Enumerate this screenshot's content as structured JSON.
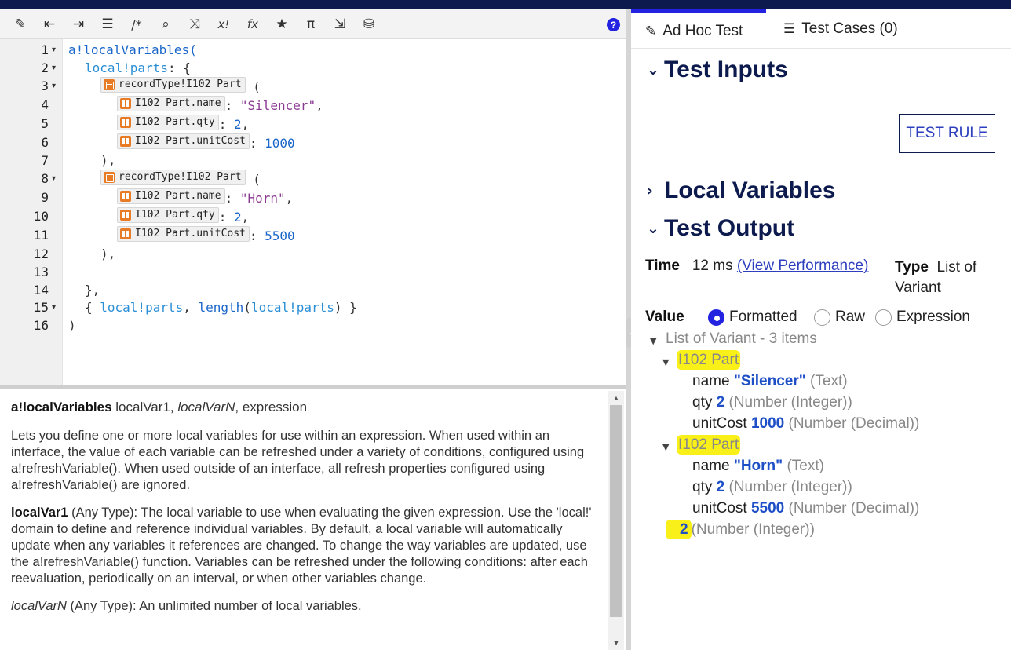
{
  "toolbar": {
    "icons": [
      "magic-wand-icon",
      "outdent-icon",
      "indent-icon",
      "list-icon",
      "comment-icon",
      "search-icon",
      "shuffle-icon",
      "x-factorial-icon",
      "function-icon",
      "star-icon",
      "pi-icon",
      "export-icon",
      "database-search-icon"
    ],
    "glyphs": [
      "✎",
      "⇤",
      "⇥",
      "☰",
      "/*",
      "⌕",
      "⤨",
      "x!",
      "fx",
      "★",
      "π",
      "⇲",
      "⛁"
    ],
    "help": "?"
  },
  "editor": {
    "line_numbers": [
      "1",
      "2",
      "3",
      "4",
      "5",
      "6",
      "7",
      "8",
      "9",
      "10",
      "11",
      "12",
      "13",
      "14",
      "15",
      "16"
    ],
    "folds": [
      "▾",
      "▾",
      "▾",
      "",
      "",
      "",
      "",
      "▾",
      "",
      "",
      "",
      "",
      "",
      "",
      "▾",
      ""
    ],
    "code": {
      "l1": "a!localVariables(",
      "l2_var": "local!parts",
      "l2_rest": ": {",
      "rec_type": "recordType!I102 Part",
      "paren_open": "(",
      "field_name": "I102 Part.name",
      "field_qty": "I102 Part.qty",
      "field_cost": "I102 Part.unitCost",
      "colon": ": ",
      "v_silencer": "\"Silencer\"",
      "v_horn": "\"Horn\"",
      "v_qty": "2",
      "v_cost1": "1000",
      "v_cost2": "5500",
      "comma": ",",
      "close_paren": "),",
      "close_brace": "},",
      "l15_a": "{ ",
      "l15_var": "local!parts",
      "l15_b": ", ",
      "l15_fn": "length",
      "l15_c": "(",
      "l15_var2": "local!parts",
      "l15_d": ") }",
      "l16": ")"
    }
  },
  "docs": {
    "fn_name": "a!localVariables",
    "sig_params": " localVar1, ",
    "sig_varn": "localVarN",
    "sig_end": ", expression",
    "p1": "Lets you define one or more local variables for use within an expression. When used within an interface, the value of each variable can be refreshed under a variety of conditions, configured using a!refreshVariable(). When used outside of an interface, all refresh properties configured using a!refreshVariable() are ignored.",
    "p2_name": "localVar1",
    "p2_text": " (Any Type): The local variable to use when evaluating the given expression. Use the 'local!' domain to define and reference individual variables. By default, a local variable will automatically update when any variables it references are changed. To change the way variables are updated, use the a!refreshVariable() function. Variables can be refreshed under the following conditions: after each reevaluation, periodically on an interval, or when other variables change.",
    "p3_name": "localVarN",
    "p3_text": " (Any Type): An unlimited number of local variables."
  },
  "tabs": {
    "adhoc": "Ad Hoc Test",
    "adhoc_icon": "✎",
    "cases": "Test Cases (0)",
    "cases_icon": "☰"
  },
  "panel": {
    "test_inputs": "Test Inputs",
    "local_variables": "Local Variables",
    "test_output": "Test Output",
    "test_rule": "TEST RULE",
    "time_label": "Time",
    "time_value": "12 ms",
    "view_perf": "(View Performance)",
    "type_label": "Type",
    "type_value": "List of",
    "type_value2": "Variant",
    "value_label": "Value",
    "radio": [
      "Formatted",
      "Raw",
      "Expression"
    ],
    "selected_radio": "Formatted"
  },
  "output": {
    "root": "List of Variant - 3 items",
    "item_label": "I102 Part",
    "items": [
      {
        "name_key": "name",
        "name_val": "\"Silencer\"",
        "name_type": "(Text)",
        "qty_key": "qty",
        "qty_val": "2",
        "qty_type": "(Number (Integer))",
        "cost_key": "unitCost",
        "cost_val": "1000",
        "cost_type": "(Number (Decimal))"
      },
      {
        "name_key": "name",
        "name_val": "\"Horn\"",
        "name_type": "(Text)",
        "qty_key": "qty",
        "qty_val": "2",
        "qty_type": "(Number (Integer))",
        "cost_key": "unitCost",
        "cost_val": "5500",
        "cost_type": "(Number (Decimal))"
      }
    ],
    "last_val": "2",
    "last_type": "(Number (Integer))"
  },
  "colors": {
    "accent": "#2322e0",
    "heading": "#0c1a4e",
    "highlight": "#f9f01a",
    "chip_icon": "#e87b25"
  }
}
